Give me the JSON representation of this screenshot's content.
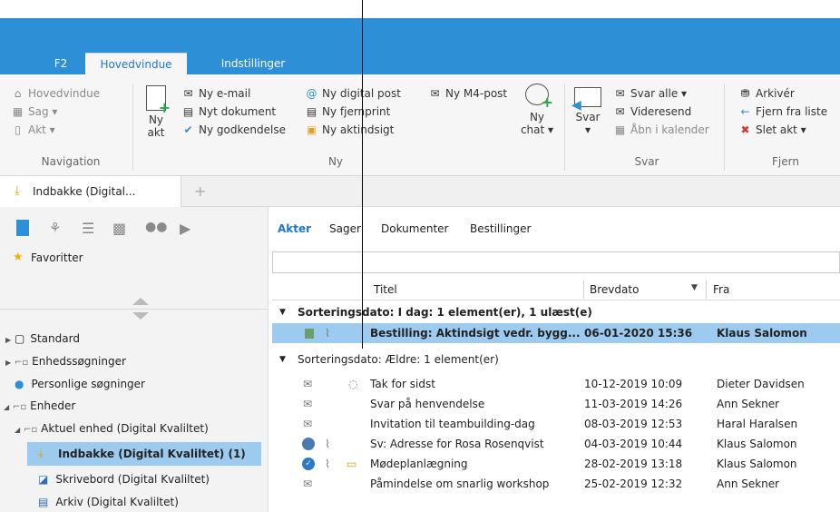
{
  "tabs": {
    "f2": "F2",
    "main": "Hovedvindue",
    "settings": "Indstillinger"
  },
  "ribbon": {
    "nav": {
      "hovedvindue": "Hovedvindue",
      "sag": "Sag ▾",
      "akt": "Akt ▾",
      "group": "Navigation"
    },
    "ny": {
      "ny_akt_1": "Ny",
      "ny_akt_2": "akt",
      "email": "Ny e-mail",
      "dokument": "Nyt dokument",
      "godkendelse": "Ny godkendelse",
      "digital_post": "Ny digital post",
      "m4_post": "Ny M4-post",
      "fjernprint": "Ny fjernprint",
      "aktindsigt": "Ny aktindsigt",
      "chat_1": "Ny",
      "chat_2": "chat ▾",
      "group": "Ny"
    },
    "svar": {
      "svar_1": "Svar",
      "svar_2": "▾",
      "svar_alle": "Svar alle ▾",
      "videresend": "Videresend",
      "kalender": "Åbn i kalender",
      "group": "Svar"
    },
    "fjern": {
      "arkiver": "Arkivér",
      "fjern_liste": "Fjern fra liste",
      "slet": "Slet akt ▾",
      "group": "Fjern"
    }
  },
  "doc_tab": {
    "label": "Indbakke (Digital...",
    "add": "+"
  },
  "left": {
    "favoritter": "Favoritter",
    "standard": "Standard",
    "enhedssogninger": "Enhedssøgninger",
    "personlige": "Personlige søgninger",
    "enheder": "Enheder",
    "aktuel": "Aktuel enhed (Digital Kvaliltet)",
    "indbakke": "Indbakke (Digital Kvaliltet) (1)",
    "skrivebord": "Skrivebord (Digital Kvaliltet)",
    "arkiv": "Arkiv (Digital Kvaliltet)"
  },
  "content_tabs": {
    "akter": "Akter",
    "sager": "Sager",
    "dokumenter": "Dokumenter",
    "bestillinger": "Bestillinger"
  },
  "columns": {
    "titel": "Titel",
    "brevdato": "Brevdato",
    "fra": "Fra"
  },
  "group1": "Sorteringsdato: I dag: 1 element(er), 1 ulæst(e)",
  "group2": "Sorteringsdato: Ældre: 1 element(er)",
  "rows": [
    {
      "title": "Bestilling: Aktindsigt vedr. bygg...",
      "date": "06-01-2020 15:36",
      "from": "Klaus Salomon"
    },
    {
      "title": "Tak for sidst",
      "date": "10-12-2019 10:09",
      "from": "Dieter Davidsen"
    },
    {
      "title": "Svar på henvendelse",
      "date": "11-03-2019 14:26",
      "from": "Ann Sekner"
    },
    {
      "title": "Invitation til teambuilding-dag",
      "date": "08-03-2019 12:53",
      "from": "Haral Haralsen"
    },
    {
      "title": "Sv: Adresse for Rosa Rosenqvist",
      "date": "04-03-2019 10:44",
      "from": "Klaus Salomon"
    },
    {
      "title": "Mødeplanlægning",
      "date": "28-02-2019 13:18",
      "from": "Klaus Salomon"
    },
    {
      "title": "Påmindelse om snarlig workshop",
      "date": "25-02-2019 12:32",
      "from": "Ann Sekner"
    }
  ],
  "colors": {
    "accent": "#2d8fd6",
    "selected": "#9ccbef"
  }
}
